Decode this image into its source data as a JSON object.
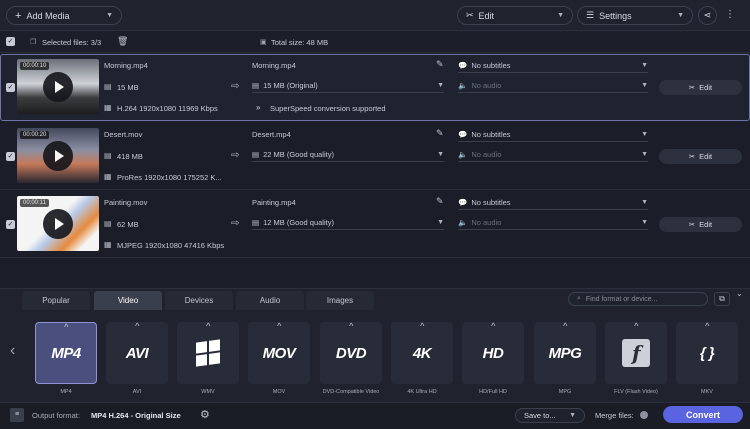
{
  "toolbar": {
    "add_media": "Add Media",
    "edit": "Edit",
    "settings": "Settings"
  },
  "selection": {
    "selected_files": "Selected files: 3/3",
    "total_size": "Total size: 48 MB"
  },
  "files": [
    {
      "duration": "00:00:10",
      "source_name": "Morning.mp4",
      "source_size": "15 MB",
      "source_info": "H.264 1920x1080 11969 Kbps",
      "output_name": "Morning.mp4",
      "output_size": "15 MB (Original)",
      "note": "SuperSpeed conversion supported",
      "subtitles": "No subtitles",
      "audio": "No audio",
      "edit_label": "Edit"
    },
    {
      "duration": "00:00:20",
      "source_name": "Desert.mov",
      "source_size": "418 MB",
      "source_info": "ProRes 1920x1080 175252 K...",
      "output_name": "Desert.mp4",
      "output_size": "22 MB (Good quality)",
      "note": "",
      "subtitles": "No subtitles",
      "audio": "No audio",
      "edit_label": "Edit"
    },
    {
      "duration": "00:00:11",
      "source_name": "Painting.mov",
      "source_size": "62 MB",
      "source_info": "MJPEG 1920x1080 47416 Kbps",
      "output_name": "Painting.mp4",
      "output_size": "12 MB (Good quality)",
      "note": "",
      "subtitles": "No subtitles",
      "audio": "No audio",
      "edit_label": "Edit"
    }
  ],
  "tabs": [
    "Popular",
    "Video",
    "Devices",
    "Audio",
    "Images"
  ],
  "active_tab": "Video",
  "search": {
    "placeholder": "Find format or device..."
  },
  "formats": [
    {
      "icon_text": "MP4",
      "label": "MP4"
    },
    {
      "icon_text": "AVI",
      "label": "AVI"
    },
    {
      "icon_text": "",
      "label": "WMV"
    },
    {
      "icon_text": "MOV",
      "label": "MOV"
    },
    {
      "icon_text": "DVD",
      "label": "DVD-Compatible Video"
    },
    {
      "icon_text": "4K",
      "label": "4K Ultra HD"
    },
    {
      "icon_text": "HD",
      "label": "HD/Full HD"
    },
    {
      "icon_text": "MPG",
      "label": "MPG"
    },
    {
      "icon_text": "f",
      "label": "FLV (Flash Video)"
    },
    {
      "icon_text": "{ }",
      "label": "MKV"
    }
  ],
  "bottom": {
    "output_format_label": "Output format:",
    "output_format_value": "MP4 H.264 - Original Size",
    "save_to": "Save to...",
    "merge_files": "Merge files:",
    "convert": "Convert"
  },
  "colors": {
    "accent": "#5a63e0",
    "selection_border": "#6f74a8"
  }
}
